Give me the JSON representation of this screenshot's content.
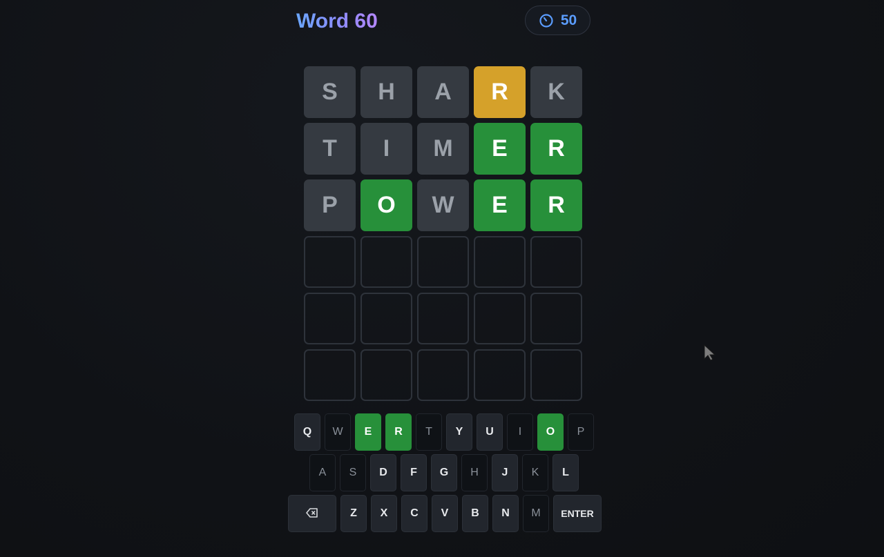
{
  "header": {
    "title": "Word 60",
    "timer_value": "50",
    "timer_icon": "timer-icon"
  },
  "board": {
    "rows": [
      [
        {
          "letter": "S",
          "state": "absent"
        },
        {
          "letter": "H",
          "state": "absent"
        },
        {
          "letter": "A",
          "state": "absent"
        },
        {
          "letter": "R",
          "state": "present"
        },
        {
          "letter": "K",
          "state": "absent"
        }
      ],
      [
        {
          "letter": "T",
          "state": "absent"
        },
        {
          "letter": "I",
          "state": "absent"
        },
        {
          "letter": "M",
          "state": "absent"
        },
        {
          "letter": "E",
          "state": "correct"
        },
        {
          "letter": "R",
          "state": "correct"
        }
      ],
      [
        {
          "letter": "P",
          "state": "absent"
        },
        {
          "letter": "O",
          "state": "correct"
        },
        {
          "letter": "W",
          "state": "absent"
        },
        {
          "letter": "E",
          "state": "correct"
        },
        {
          "letter": "R",
          "state": "correct"
        }
      ],
      [
        {
          "letter": "",
          "state": "empty"
        },
        {
          "letter": "",
          "state": "empty"
        },
        {
          "letter": "",
          "state": "empty"
        },
        {
          "letter": "",
          "state": "empty"
        },
        {
          "letter": "",
          "state": "empty"
        }
      ],
      [
        {
          "letter": "",
          "state": "empty"
        },
        {
          "letter": "",
          "state": "empty"
        },
        {
          "letter": "",
          "state": "empty"
        },
        {
          "letter": "",
          "state": "empty"
        },
        {
          "letter": "",
          "state": "empty"
        }
      ],
      [
        {
          "letter": "",
          "state": "empty"
        },
        {
          "letter": "",
          "state": "empty"
        },
        {
          "letter": "",
          "state": "empty"
        },
        {
          "letter": "",
          "state": "empty"
        },
        {
          "letter": "",
          "state": "empty"
        }
      ]
    ]
  },
  "keyboard": {
    "row1": [
      {
        "label": "Q",
        "state": "unused"
      },
      {
        "label": "W",
        "state": "absent"
      },
      {
        "label": "E",
        "state": "correct"
      },
      {
        "label": "R",
        "state": "correct"
      },
      {
        "label": "T",
        "state": "absent"
      },
      {
        "label": "Y",
        "state": "unused"
      },
      {
        "label": "U",
        "state": "unused"
      },
      {
        "label": "I",
        "state": "absent"
      },
      {
        "label": "O",
        "state": "correct"
      },
      {
        "label": "P",
        "state": "absent"
      }
    ],
    "row2": [
      {
        "label": "A",
        "state": "absent"
      },
      {
        "label": "S",
        "state": "absent"
      },
      {
        "label": "D",
        "state": "unused"
      },
      {
        "label": "F",
        "state": "unused"
      },
      {
        "label": "G",
        "state": "unused"
      },
      {
        "label": "H",
        "state": "absent"
      },
      {
        "label": "J",
        "state": "unused"
      },
      {
        "label": "K",
        "state": "absent"
      },
      {
        "label": "L",
        "state": "unused"
      }
    ],
    "row3": [
      {
        "label": "",
        "state": "unused",
        "icon": "backspace-icon",
        "wide": true
      },
      {
        "label": "Z",
        "state": "unused"
      },
      {
        "label": "X",
        "state": "unused"
      },
      {
        "label": "C",
        "state": "unused"
      },
      {
        "label": "V",
        "state": "unused"
      },
      {
        "label": "B",
        "state": "unused"
      },
      {
        "label": "N",
        "state": "unused"
      },
      {
        "label": "M",
        "state": "absent"
      },
      {
        "label": "ENTER",
        "state": "unused",
        "wide": true
      }
    ]
  },
  "colors": {
    "correct": "#27903a",
    "present": "#d5a12a",
    "absent": "#353a41",
    "timer_accent": "#5b9dff"
  }
}
